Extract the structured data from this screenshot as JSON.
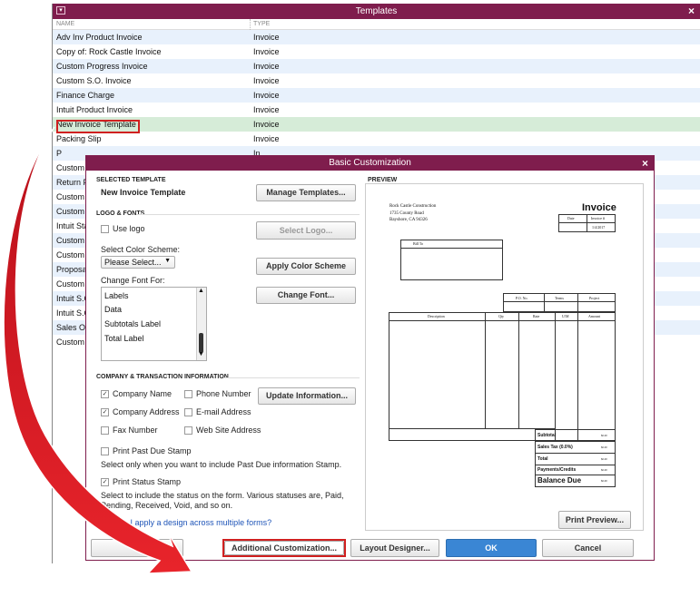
{
  "templates_window": {
    "title": "Templates",
    "col_name": "NAME",
    "col_type": "TYPE",
    "rows": [
      {
        "name": "Adv Inv Product Invoice",
        "type": "Invoice"
      },
      {
        "name": "Copy of: Rock Castle Invoice",
        "type": "Invoice"
      },
      {
        "name": "Custom Progress Invoice",
        "type": "Invoice"
      },
      {
        "name": "Custom S.O. Invoice",
        "type": "Invoice"
      },
      {
        "name": "Finance Charge",
        "type": "Invoice"
      },
      {
        "name": "Intuit Product Invoice",
        "type": "Invoice"
      },
      {
        "name": "New Invoice Template",
        "type": "Invoice"
      },
      {
        "name": "Packing Slip",
        "type": "Invoice"
      },
      {
        "name": "P",
        "type": "In"
      },
      {
        "name": "Custom",
        "type": ""
      },
      {
        "name": "Return F",
        "type": ""
      },
      {
        "name": "Custom",
        "type": ""
      },
      {
        "name": "Custom",
        "type": ""
      },
      {
        "name": "Intuit Sta",
        "type": ""
      },
      {
        "name": "Custom",
        "type": ""
      },
      {
        "name": "Custom",
        "type": ""
      },
      {
        "name": "Proposa",
        "type": ""
      },
      {
        "name": "Custom",
        "type": ""
      },
      {
        "name": "Intuit S.C",
        "type": ""
      },
      {
        "name": "Intuit S.C",
        "type": ""
      },
      {
        "name": "Sales O",
        "type": ""
      },
      {
        "name": "Custom",
        "type": ""
      }
    ]
  },
  "dialog": {
    "title": "Basic Customization",
    "selected_template_header": "SELECTED TEMPLATE",
    "selected_template_name": "New Invoice Template",
    "manage_templates": "Manage Templates...",
    "logo_fonts_header": "LOGO & FONTS",
    "use_logo": "Use logo",
    "select_logo": "Select Logo...",
    "select_color_scheme": "Select Color Scheme:",
    "color_scheme_value": "Please Select...",
    "apply_color_scheme": "Apply Color Scheme",
    "change_font_for": "Change Font For:",
    "font_items": [
      "Labels",
      "Data",
      "Subtotals Label",
      "Total Label"
    ],
    "change_font": "Change Font...",
    "company_info_header": "COMPANY & TRANSACTION INFORMATION",
    "company_name": "Company Name",
    "phone_number": "Phone Number",
    "company_address": "Company Address",
    "email_address": "E-mail Address",
    "fax_number": "Fax Number",
    "web_site_address": "Web Site Address",
    "update_information": "Update Information...",
    "print_past_due_stamp": "Print Past Due Stamp",
    "past_due_note": "Select only when you want to include Past Due information Stamp.",
    "print_status_stamp": "Print Status Stamp",
    "status_note": "Select to include the status on the form. Various statuses are, Paid, Pending, Received, Void, and so on.",
    "help_link": "w do I apply a design across multiple forms?",
    "preview_header": "PREVIEW",
    "print_preview": "Print Preview...",
    "additional_customization": "Additional Customization...",
    "layout_designer": "Layout Designer...",
    "ok": "OK",
    "cancel": "Cancel"
  },
  "preview_invoice": {
    "company": "Rock Castle Construction",
    "address1": "1735 County Road",
    "address2": "Bayshore, CA 94326",
    "title": "Invoice",
    "date_label": "Date",
    "invoice_no_label": "Invoice #",
    "date_value": "1/4/2017",
    "bill_to": "Bill To",
    "po_no": "P.O. No.",
    "terms": "Terms",
    "project": "Project",
    "description": "Description",
    "qty": "Qty",
    "rate": "Rate",
    "um": "U/M",
    "amount": "Amount",
    "subtotal": "Subtotal",
    "sales_tax": "Sales Tax (0.0%)",
    "total": "Total",
    "payments_credits": "Payments/Credits",
    "balance_due": "Balance Due",
    "zero": "$0.00"
  },
  "colors": {
    "title_bar": "#7f1d4d",
    "highlight": "#d02020",
    "ok_button": "#3a86d4"
  }
}
